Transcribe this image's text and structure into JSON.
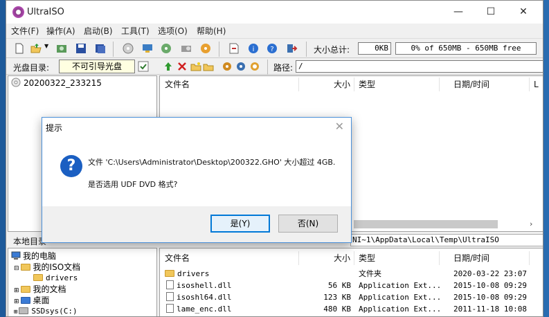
{
  "window": {
    "title": "UltraISO",
    "minimize": "—",
    "maximize": "☐",
    "close": "✕"
  },
  "menu": [
    "文件(F)",
    "操作(A)",
    "启动(B)",
    "工具(T)",
    "选项(O)",
    "帮助(H)"
  ],
  "toolbar": {
    "total_label": "大小总计:",
    "total_value": "0KB",
    "usage_text": "0% of 650MB - 650MB free"
  },
  "iso_bar": {
    "label": "光盘目录:",
    "boot_status": "不可引导光盘",
    "path_label": "路径:",
    "path_value": "/"
  },
  "iso_tree": {
    "root": "20200322_233215"
  },
  "iso_list": {
    "headers": [
      "文件名",
      "大小",
      "类型",
      "日期/时间",
      "L"
    ]
  },
  "local_bar": {
    "label": "本地目录",
    "path_value": "NI~1\\AppData\\Local\\Temp\\UltraISO"
  },
  "local_tree": {
    "items": [
      "我的电脑",
      "我的ISO文档",
      "drivers",
      "我的文档",
      "桌面",
      "SSDsys(C:)"
    ]
  },
  "local_list": {
    "headers": [
      "文件名",
      "大小",
      "类型",
      "日期/时间"
    ],
    "rows": [
      {
        "name": "drivers",
        "size": "",
        "type": "文件夹",
        "date": "2020-03-22 23:07"
      },
      {
        "name": "isoshell.dll",
        "size": "56 KB",
        "type": "Application Ext...",
        "date": "2015-10-08 09:29"
      },
      {
        "name": "isoshl64.dll",
        "size": "123 KB",
        "type": "Application Ext...",
        "date": "2015-10-08 09:29"
      },
      {
        "name": "lame_enc.dll",
        "size": "480 KB",
        "type": "Application Ext...",
        "date": "2011-11-18 10:08"
      }
    ]
  },
  "dialog": {
    "title": "提示",
    "close": "✕",
    "icon": "question-icon",
    "line1": "文件 'C:\\Users\\Administrator\\Desktop\\200322.GHO' 大小超过 4GB.",
    "line2": "是否选用 UDF DVD 格式?",
    "yes": "是(Y)",
    "no": "否(N)"
  }
}
